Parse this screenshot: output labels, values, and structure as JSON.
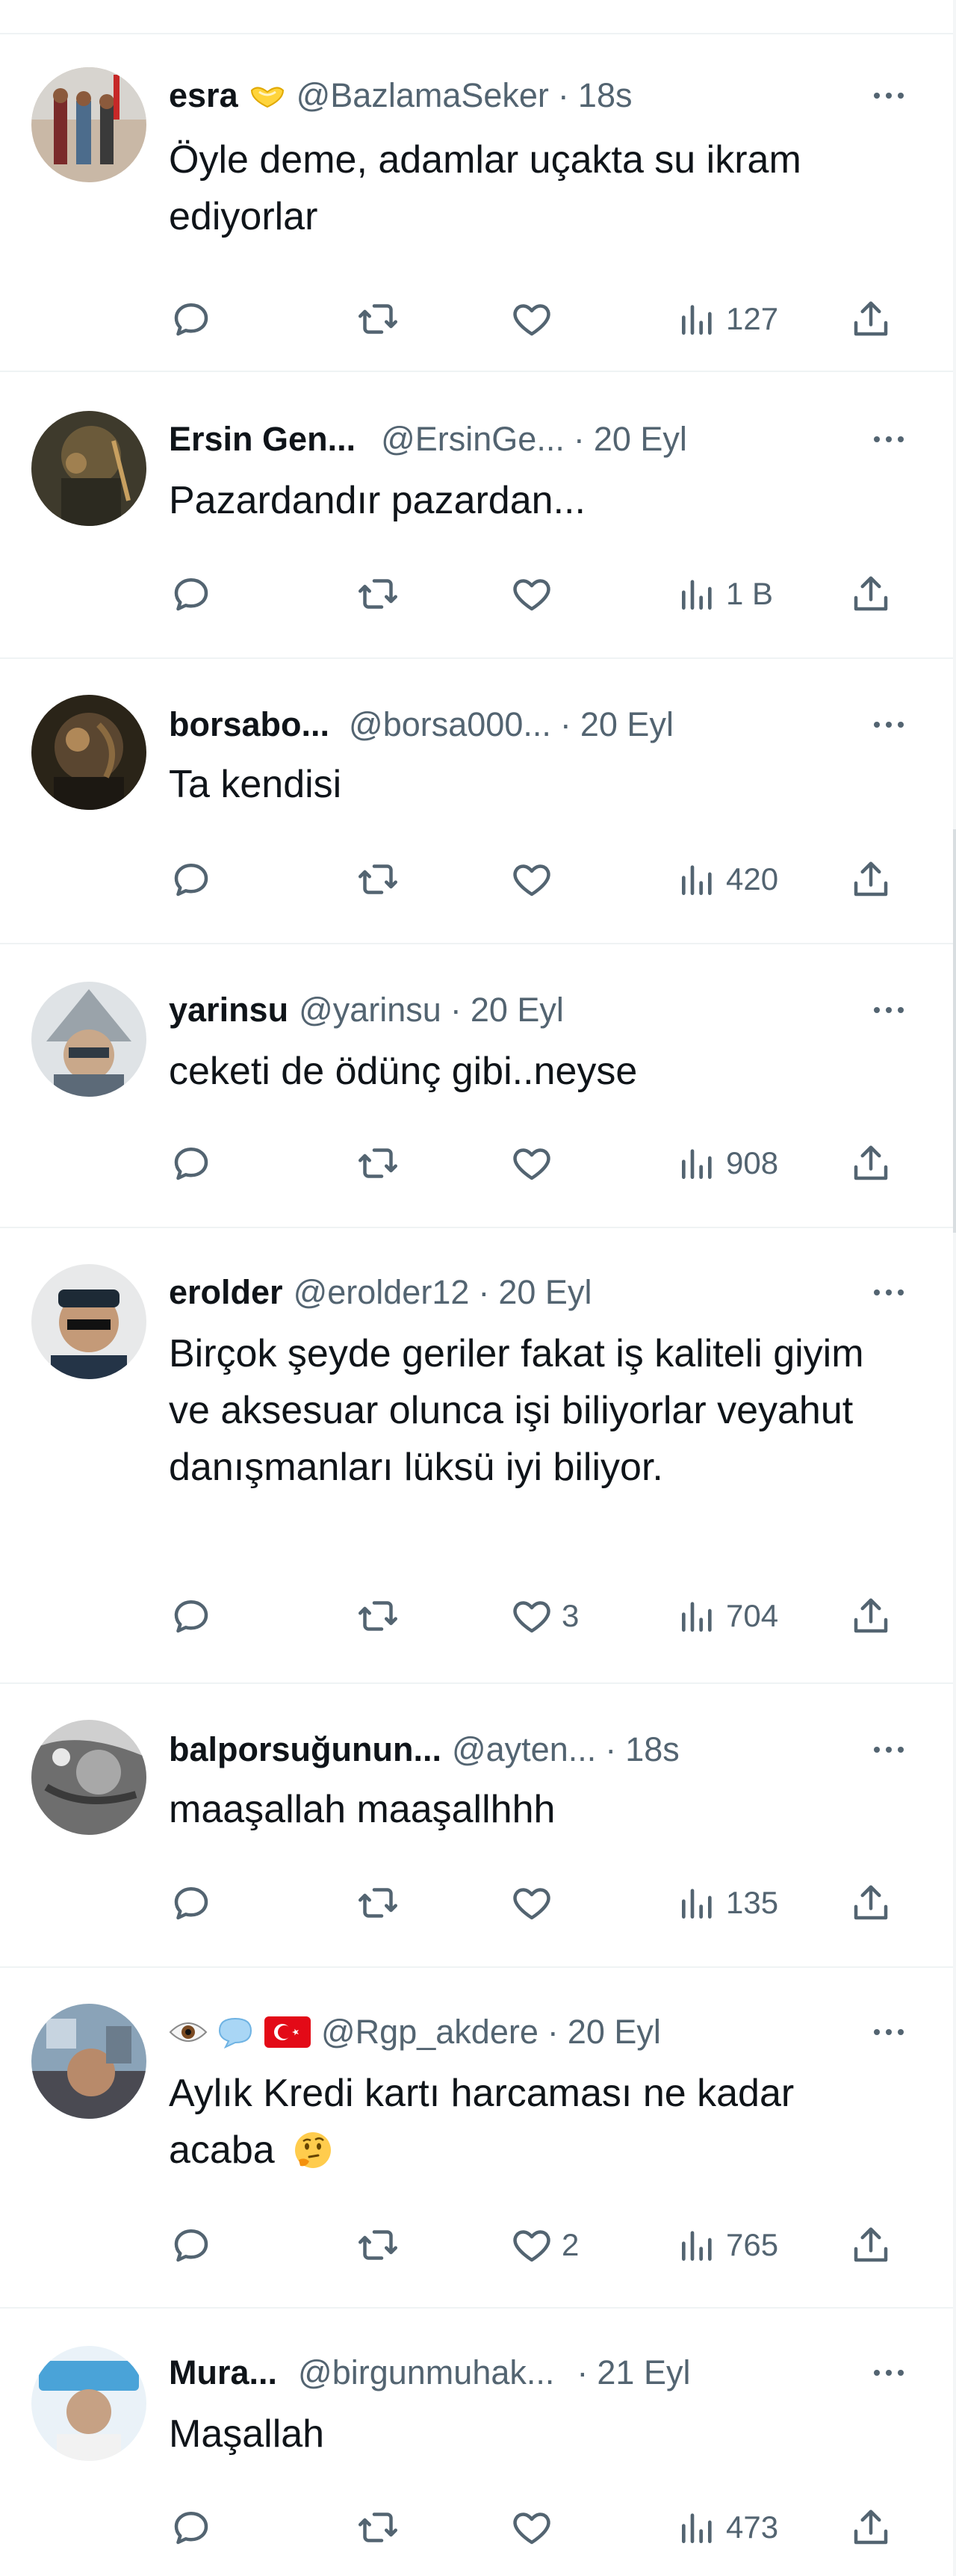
{
  "tweets": [
    {
      "name": "esra",
      "badge": "yellow-heart-hands",
      "handle": "@BazlamaSeker",
      "separator": "·",
      "time": "18s",
      "text": "Öyle deme, adamlar uçakta su ikram ediyorlar",
      "likes": "",
      "views": "127"
    },
    {
      "name": "Ersin Gen...",
      "handle": "@ErsinGe...",
      "separator": "·",
      "time": "20 Eyl",
      "text": "Pazardandır pazardan...",
      "likes": "",
      "views": "1 B"
    },
    {
      "name": "borsabo...",
      "handle": "@borsa000...",
      "separator": "·",
      "time": "20 Eyl",
      "text": "Ta kendisi",
      "likes": "",
      "views": "420"
    },
    {
      "name": "yarinsu",
      "handle": "@yarinsu",
      "separator": "·",
      "time": "20 Eyl",
      "text": "ceketi de ödünç gibi..neyse",
      "likes": "",
      "views": "908"
    },
    {
      "name": "erolder",
      "handle": "@erolder12",
      "separator": "·",
      "time": "20 Eyl",
      "text": "Birçok şeyde geriler fakat iş kaliteli giyim ve aksesuar olunca işi biliyorlar veyahut danışmanları lüksü iyi biliyor.",
      "likes": "3",
      "views": "704"
    },
    {
      "name": "balporsuğunun...",
      "handle": "@ayten...",
      "separator": "·",
      "time": "18s",
      "text": "maaşallah maaşallhhh",
      "likes": "",
      "views": "135"
    },
    {
      "name": "",
      "name_emoji": [
        "eye",
        "speech-bubble",
        "turkey-flag"
      ],
      "handle": "@Rgp_akdere",
      "separator": "·",
      "time": "20 Eyl",
      "text": "Aylık Kredi kartı harcaması ne kadar acaba",
      "text_emoji": "thinking-face",
      "likes": "2",
      "views": "765"
    },
    {
      "name": "Mura...",
      "handle": "@birgunmuhak...",
      "separator": "·",
      "time": "21 Eyl",
      "text": "Maşallah",
      "likes": "",
      "views": "473"
    }
  ],
  "colors": {
    "text_primary": "#0f1419",
    "text_secondary": "#536471",
    "divider": "#eff3f4"
  }
}
